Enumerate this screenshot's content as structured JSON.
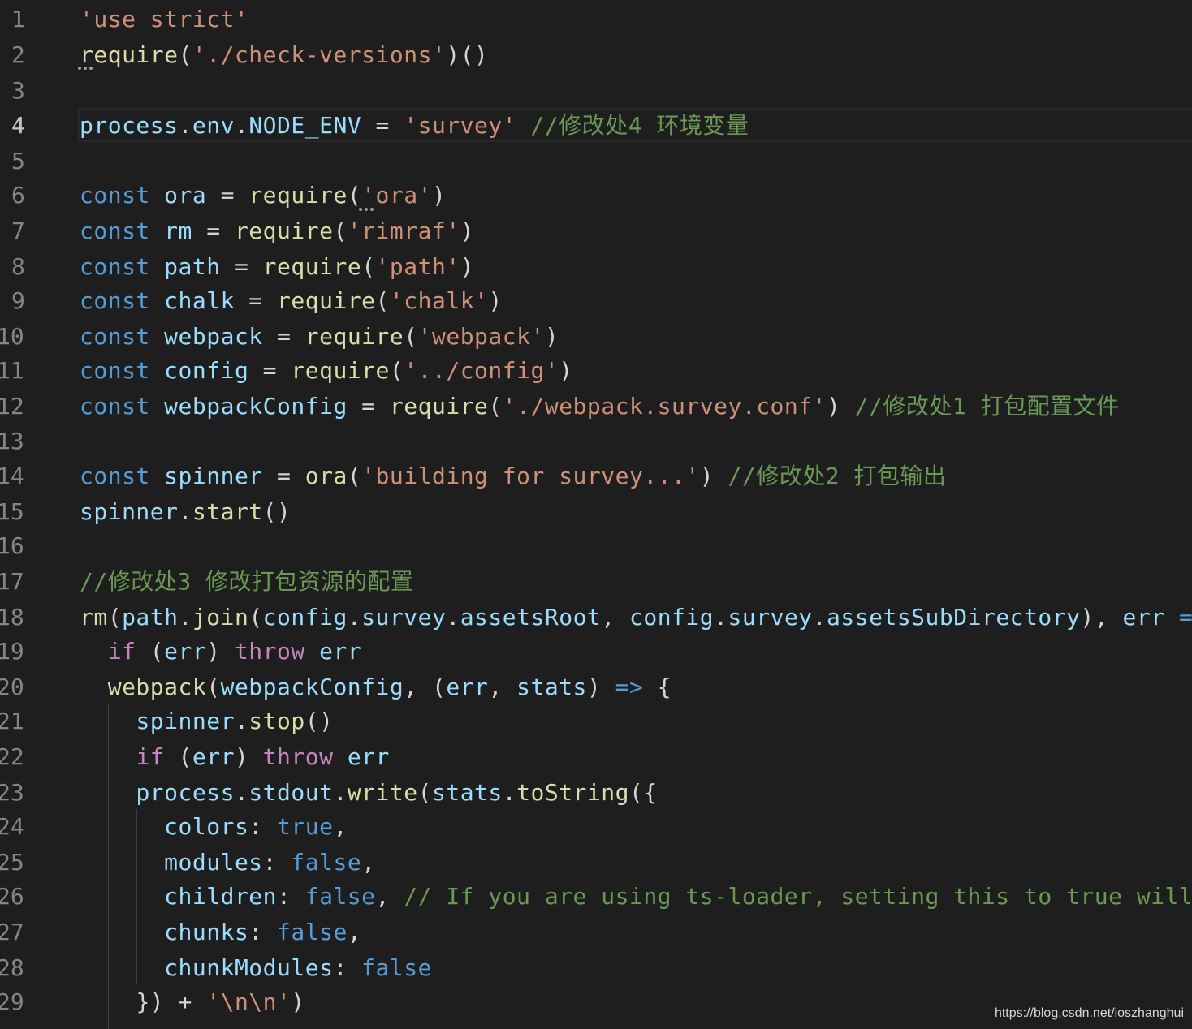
{
  "editor": {
    "language": "javascript",
    "active_line": 4,
    "lines": [
      {
        "n": "1",
        "tokens": [
          {
            "t": "'use strict'",
            "c": "string"
          }
        ]
      },
      {
        "n": "2",
        "tokens": [
          {
            "t": "require",
            "c": "fn"
          },
          {
            "t": "(",
            "c": "punct"
          },
          {
            "t": "'./check-versions'",
            "c": "string"
          },
          {
            "t": ")()",
            "c": "punct"
          }
        ]
      },
      {
        "n": "3",
        "tokens": []
      },
      {
        "n": "4",
        "tokens": [
          {
            "t": "process",
            "c": "var"
          },
          {
            "t": ".",
            "c": "punct"
          },
          {
            "t": "env",
            "c": "var"
          },
          {
            "t": ".",
            "c": "punct"
          },
          {
            "t": "NODE_ENV",
            "c": "var"
          },
          {
            "t": " = ",
            "c": "punct"
          },
          {
            "t": "'survey'",
            "c": "string"
          },
          {
            "t": " ",
            "c": "punct"
          },
          {
            "t": "//修改处4 环境变量",
            "c": "comment"
          }
        ]
      },
      {
        "n": "5",
        "tokens": []
      },
      {
        "n": "6",
        "tokens": [
          {
            "t": "const",
            "c": "keyword"
          },
          {
            "t": " ",
            "c": "punct"
          },
          {
            "t": "ora",
            "c": "var"
          },
          {
            "t": " = ",
            "c": "punct"
          },
          {
            "t": "require",
            "c": "fn"
          },
          {
            "t": "(",
            "c": "punct"
          },
          {
            "t": "'ora'",
            "c": "string"
          },
          {
            "t": ")",
            "c": "punct"
          }
        ]
      },
      {
        "n": "7",
        "tokens": [
          {
            "t": "const",
            "c": "keyword"
          },
          {
            "t": " ",
            "c": "punct"
          },
          {
            "t": "rm",
            "c": "var"
          },
          {
            "t": " = ",
            "c": "punct"
          },
          {
            "t": "require",
            "c": "fn"
          },
          {
            "t": "(",
            "c": "punct"
          },
          {
            "t": "'rimraf'",
            "c": "string"
          },
          {
            "t": ")",
            "c": "punct"
          }
        ]
      },
      {
        "n": "8",
        "tokens": [
          {
            "t": "const",
            "c": "keyword"
          },
          {
            "t": " ",
            "c": "punct"
          },
          {
            "t": "path",
            "c": "var"
          },
          {
            "t": " = ",
            "c": "punct"
          },
          {
            "t": "require",
            "c": "fn"
          },
          {
            "t": "(",
            "c": "punct"
          },
          {
            "t": "'path'",
            "c": "string"
          },
          {
            "t": ")",
            "c": "punct"
          }
        ]
      },
      {
        "n": "9",
        "tokens": [
          {
            "t": "const",
            "c": "keyword"
          },
          {
            "t": " ",
            "c": "punct"
          },
          {
            "t": "chalk",
            "c": "var"
          },
          {
            "t": " = ",
            "c": "punct"
          },
          {
            "t": "require",
            "c": "fn"
          },
          {
            "t": "(",
            "c": "punct"
          },
          {
            "t": "'chalk'",
            "c": "string"
          },
          {
            "t": ")",
            "c": "punct"
          }
        ]
      },
      {
        "n": "10",
        "tokens": [
          {
            "t": "const",
            "c": "keyword"
          },
          {
            "t": " ",
            "c": "punct"
          },
          {
            "t": "webpack",
            "c": "var"
          },
          {
            "t": " = ",
            "c": "punct"
          },
          {
            "t": "require",
            "c": "fn"
          },
          {
            "t": "(",
            "c": "punct"
          },
          {
            "t": "'webpack'",
            "c": "string"
          },
          {
            "t": ")",
            "c": "punct"
          }
        ]
      },
      {
        "n": "11",
        "tokens": [
          {
            "t": "const",
            "c": "keyword"
          },
          {
            "t": " ",
            "c": "punct"
          },
          {
            "t": "config",
            "c": "var"
          },
          {
            "t": " = ",
            "c": "punct"
          },
          {
            "t": "require",
            "c": "fn"
          },
          {
            "t": "(",
            "c": "punct"
          },
          {
            "t": "'../config'",
            "c": "string"
          },
          {
            "t": ")",
            "c": "punct"
          }
        ]
      },
      {
        "n": "12",
        "tokens": [
          {
            "t": "const",
            "c": "keyword"
          },
          {
            "t": " ",
            "c": "punct"
          },
          {
            "t": "webpackConfig",
            "c": "var"
          },
          {
            "t": " = ",
            "c": "punct"
          },
          {
            "t": "require",
            "c": "fn"
          },
          {
            "t": "(",
            "c": "punct"
          },
          {
            "t": "'./webpack.survey.conf'",
            "c": "string"
          },
          {
            "t": ") ",
            "c": "punct"
          },
          {
            "t": "//修改处1 打包配置文件",
            "c": "comment"
          }
        ]
      },
      {
        "n": "13",
        "tokens": []
      },
      {
        "n": "14",
        "tokens": [
          {
            "t": "const",
            "c": "keyword"
          },
          {
            "t": " ",
            "c": "punct"
          },
          {
            "t": "spinner",
            "c": "var"
          },
          {
            "t": " = ",
            "c": "punct"
          },
          {
            "t": "ora",
            "c": "fn"
          },
          {
            "t": "(",
            "c": "punct"
          },
          {
            "t": "'building for survey...'",
            "c": "string"
          },
          {
            "t": ") ",
            "c": "punct"
          },
          {
            "t": "//修改处2 打包输出",
            "c": "comment"
          }
        ]
      },
      {
        "n": "15",
        "tokens": [
          {
            "t": "spinner",
            "c": "var"
          },
          {
            "t": ".",
            "c": "punct"
          },
          {
            "t": "start",
            "c": "fn"
          },
          {
            "t": "()",
            "c": "punct"
          }
        ]
      },
      {
        "n": "16",
        "tokens": []
      },
      {
        "n": "17",
        "tokens": [
          {
            "t": "//修改处3 修改打包资源的配置",
            "c": "comment"
          }
        ]
      },
      {
        "n": "18",
        "tokens": [
          {
            "t": "rm",
            "c": "fn"
          },
          {
            "t": "(",
            "c": "punct"
          },
          {
            "t": "path",
            "c": "var"
          },
          {
            "t": ".",
            "c": "punct"
          },
          {
            "t": "join",
            "c": "fn"
          },
          {
            "t": "(",
            "c": "punct"
          },
          {
            "t": "config",
            "c": "var"
          },
          {
            "t": ".",
            "c": "punct"
          },
          {
            "t": "survey",
            "c": "var"
          },
          {
            "t": ".",
            "c": "punct"
          },
          {
            "t": "assetsRoot",
            "c": "var"
          },
          {
            "t": ", ",
            "c": "punct"
          },
          {
            "t": "config",
            "c": "var"
          },
          {
            "t": ".",
            "c": "punct"
          },
          {
            "t": "survey",
            "c": "var"
          },
          {
            "t": ".",
            "c": "punct"
          },
          {
            "t": "assetsSubDirectory",
            "c": "var"
          },
          {
            "t": "), ",
            "c": "punct"
          },
          {
            "t": "err",
            "c": "var"
          },
          {
            "t": " ",
            "c": "punct"
          },
          {
            "t": "=>",
            "c": "keyword"
          }
        ]
      },
      {
        "n": "19",
        "tokens": [
          {
            "t": "  ",
            "c": "punct"
          },
          {
            "t": "if",
            "c": "control"
          },
          {
            "t": " (",
            "c": "punct"
          },
          {
            "t": "err",
            "c": "var"
          },
          {
            "t": ") ",
            "c": "punct"
          },
          {
            "t": "throw",
            "c": "control"
          },
          {
            "t": " ",
            "c": "punct"
          },
          {
            "t": "err",
            "c": "var"
          }
        ]
      },
      {
        "n": "20",
        "tokens": [
          {
            "t": "  ",
            "c": "punct"
          },
          {
            "t": "webpack",
            "c": "fn"
          },
          {
            "t": "(",
            "c": "punct"
          },
          {
            "t": "webpackConfig",
            "c": "var"
          },
          {
            "t": ", (",
            "c": "punct"
          },
          {
            "t": "err",
            "c": "var"
          },
          {
            "t": ", ",
            "c": "punct"
          },
          {
            "t": "stats",
            "c": "var"
          },
          {
            "t": ") ",
            "c": "punct"
          },
          {
            "t": "=>",
            "c": "keyword"
          },
          {
            "t": " {",
            "c": "punct"
          }
        ]
      },
      {
        "n": "21",
        "tokens": [
          {
            "t": "    ",
            "c": "punct"
          },
          {
            "t": "spinner",
            "c": "var"
          },
          {
            "t": ".",
            "c": "punct"
          },
          {
            "t": "stop",
            "c": "fn"
          },
          {
            "t": "()",
            "c": "punct"
          }
        ]
      },
      {
        "n": "22",
        "tokens": [
          {
            "t": "    ",
            "c": "punct"
          },
          {
            "t": "if",
            "c": "control"
          },
          {
            "t": " (",
            "c": "punct"
          },
          {
            "t": "err",
            "c": "var"
          },
          {
            "t": ") ",
            "c": "punct"
          },
          {
            "t": "throw",
            "c": "control"
          },
          {
            "t": " ",
            "c": "punct"
          },
          {
            "t": "err",
            "c": "var"
          }
        ]
      },
      {
        "n": "23",
        "tokens": [
          {
            "t": "    ",
            "c": "punct"
          },
          {
            "t": "process",
            "c": "var"
          },
          {
            "t": ".",
            "c": "punct"
          },
          {
            "t": "stdout",
            "c": "var"
          },
          {
            "t": ".",
            "c": "punct"
          },
          {
            "t": "write",
            "c": "fn"
          },
          {
            "t": "(",
            "c": "punct"
          },
          {
            "t": "stats",
            "c": "var"
          },
          {
            "t": ".",
            "c": "punct"
          },
          {
            "t": "toString",
            "c": "fn"
          },
          {
            "t": "({",
            "c": "punct"
          }
        ]
      },
      {
        "n": "24",
        "tokens": [
          {
            "t": "      ",
            "c": "punct"
          },
          {
            "t": "colors",
            "c": "var"
          },
          {
            "t": ": ",
            "c": "punct"
          },
          {
            "t": "true",
            "c": "bool"
          },
          {
            "t": ",",
            "c": "punct"
          }
        ]
      },
      {
        "n": "25",
        "tokens": [
          {
            "t": "      ",
            "c": "punct"
          },
          {
            "t": "modules",
            "c": "var"
          },
          {
            "t": ": ",
            "c": "punct"
          },
          {
            "t": "false",
            "c": "bool"
          },
          {
            "t": ",",
            "c": "punct"
          }
        ]
      },
      {
        "n": "26",
        "tokens": [
          {
            "t": "      ",
            "c": "punct"
          },
          {
            "t": "children",
            "c": "var"
          },
          {
            "t": ": ",
            "c": "punct"
          },
          {
            "t": "false",
            "c": "bool"
          },
          {
            "t": ", ",
            "c": "punct"
          },
          {
            "t": "// If you are using ts-loader, setting this to true will",
            "c": "comment"
          }
        ]
      },
      {
        "n": "27",
        "tokens": [
          {
            "t": "      ",
            "c": "punct"
          },
          {
            "t": "chunks",
            "c": "var"
          },
          {
            "t": ": ",
            "c": "punct"
          },
          {
            "t": "false",
            "c": "bool"
          },
          {
            "t": ",",
            "c": "punct"
          }
        ]
      },
      {
        "n": "28",
        "tokens": [
          {
            "t": "      ",
            "c": "punct"
          },
          {
            "t": "chunkModules",
            "c": "var"
          },
          {
            "t": ": ",
            "c": "punct"
          },
          {
            "t": "false",
            "c": "bool"
          }
        ]
      },
      {
        "n": "29",
        "tokens": [
          {
            "t": "    ",
            "c": "punct"
          },
          {
            "t": "}) + ",
            "c": "punct"
          },
          {
            "t": "'\\n\\n'",
            "c": "string"
          },
          {
            "t": ")",
            "c": "punct"
          }
        ]
      }
    ]
  },
  "watermark": "https://blog.csdn.net/ioszhanghui",
  "colors": {
    "background": "#1e1e1e",
    "line_number": "#858585",
    "keyword": "#569cd6",
    "control": "#c586c0",
    "variable": "#9cdcfe",
    "function": "#dcdcaa",
    "string": "#ce9178",
    "comment": "#6a9955"
  }
}
